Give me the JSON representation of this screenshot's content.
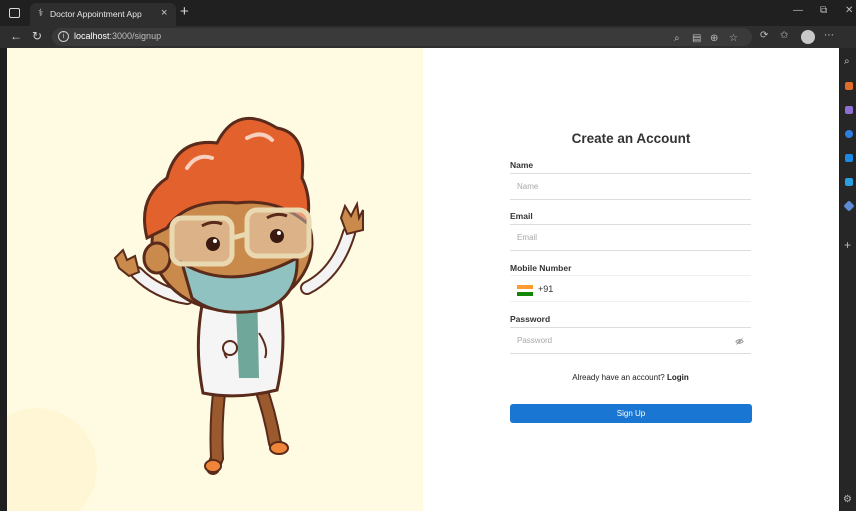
{
  "browser": {
    "tab_title": "Doctor Appointment App",
    "tab_close": "×",
    "new_tab": "+",
    "url_host": "localhost",
    "url_path": ":3000/signup",
    "minimize": "—",
    "restore": "⧉",
    "close": "✕"
  },
  "form": {
    "title": "Create an Account",
    "name_label": "Name",
    "name_placeholder": "Name",
    "email_label": "Email",
    "email_placeholder": "Email",
    "mobile_label": "Mobile Number",
    "dial_code": "+91",
    "password_label": "Password",
    "password_placeholder": "Password",
    "login_prompt": "Already have an account?",
    "login_link": "Login",
    "signup_label": "Sign Up"
  },
  "colors": {
    "primary": "#1976d2",
    "illustration_bg": "#fffbe3"
  }
}
